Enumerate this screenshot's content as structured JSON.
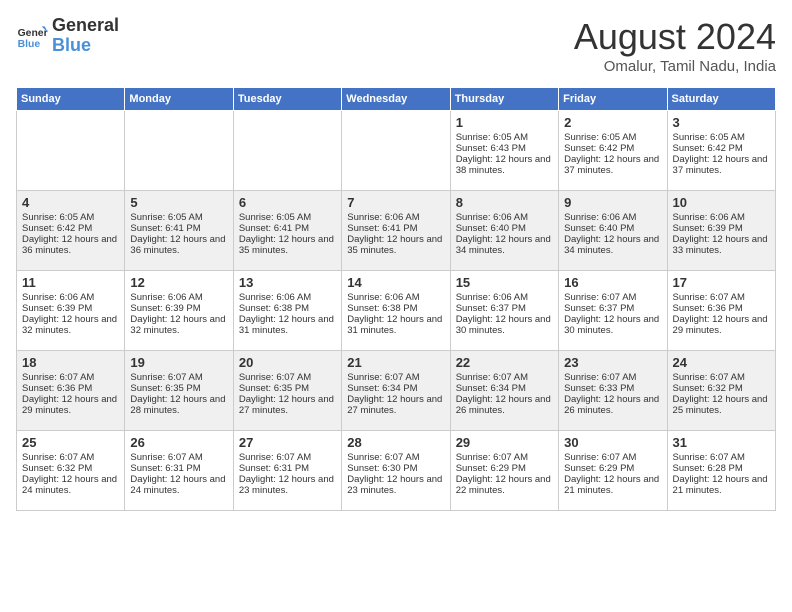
{
  "header": {
    "logo": {
      "line1": "General",
      "line2": "Blue"
    },
    "title": "August 2024",
    "subtitle": "Omalur, Tamil Nadu, India"
  },
  "weekdays": [
    "Sunday",
    "Monday",
    "Tuesday",
    "Wednesday",
    "Thursday",
    "Friday",
    "Saturday"
  ],
  "weeks": [
    [
      {
        "day": "",
        "empty": true
      },
      {
        "day": "",
        "empty": true
      },
      {
        "day": "",
        "empty": true
      },
      {
        "day": "",
        "empty": true
      },
      {
        "day": "1",
        "sunrise": "Sunrise: 6:05 AM",
        "sunset": "Sunset: 6:43 PM",
        "daylight": "Daylight: 12 hours and 38 minutes."
      },
      {
        "day": "2",
        "sunrise": "Sunrise: 6:05 AM",
        "sunset": "Sunset: 6:42 PM",
        "daylight": "Daylight: 12 hours and 37 minutes."
      },
      {
        "day": "3",
        "sunrise": "Sunrise: 6:05 AM",
        "sunset": "Sunset: 6:42 PM",
        "daylight": "Daylight: 12 hours and 37 minutes."
      }
    ],
    [
      {
        "day": "4",
        "sunrise": "Sunrise: 6:05 AM",
        "sunset": "Sunset: 6:42 PM",
        "daylight": "Daylight: 12 hours and 36 minutes."
      },
      {
        "day": "5",
        "sunrise": "Sunrise: 6:05 AM",
        "sunset": "Sunset: 6:41 PM",
        "daylight": "Daylight: 12 hours and 36 minutes."
      },
      {
        "day": "6",
        "sunrise": "Sunrise: 6:05 AM",
        "sunset": "Sunset: 6:41 PM",
        "daylight": "Daylight: 12 hours and 35 minutes."
      },
      {
        "day": "7",
        "sunrise": "Sunrise: 6:06 AM",
        "sunset": "Sunset: 6:41 PM",
        "daylight": "Daylight: 12 hours and 35 minutes."
      },
      {
        "day": "8",
        "sunrise": "Sunrise: 6:06 AM",
        "sunset": "Sunset: 6:40 PM",
        "daylight": "Daylight: 12 hours and 34 minutes."
      },
      {
        "day": "9",
        "sunrise": "Sunrise: 6:06 AM",
        "sunset": "Sunset: 6:40 PM",
        "daylight": "Daylight: 12 hours and 34 minutes."
      },
      {
        "day": "10",
        "sunrise": "Sunrise: 6:06 AM",
        "sunset": "Sunset: 6:39 PM",
        "daylight": "Daylight: 12 hours and 33 minutes."
      }
    ],
    [
      {
        "day": "11",
        "sunrise": "Sunrise: 6:06 AM",
        "sunset": "Sunset: 6:39 PM",
        "daylight": "Daylight: 12 hours and 32 minutes."
      },
      {
        "day": "12",
        "sunrise": "Sunrise: 6:06 AM",
        "sunset": "Sunset: 6:39 PM",
        "daylight": "Daylight: 12 hours and 32 minutes."
      },
      {
        "day": "13",
        "sunrise": "Sunrise: 6:06 AM",
        "sunset": "Sunset: 6:38 PM",
        "daylight": "Daylight: 12 hours and 31 minutes."
      },
      {
        "day": "14",
        "sunrise": "Sunrise: 6:06 AM",
        "sunset": "Sunset: 6:38 PM",
        "daylight": "Daylight: 12 hours and 31 minutes."
      },
      {
        "day": "15",
        "sunrise": "Sunrise: 6:06 AM",
        "sunset": "Sunset: 6:37 PM",
        "daylight": "Daylight: 12 hours and 30 minutes."
      },
      {
        "day": "16",
        "sunrise": "Sunrise: 6:07 AM",
        "sunset": "Sunset: 6:37 PM",
        "daylight": "Daylight: 12 hours and 30 minutes."
      },
      {
        "day": "17",
        "sunrise": "Sunrise: 6:07 AM",
        "sunset": "Sunset: 6:36 PM",
        "daylight": "Daylight: 12 hours and 29 minutes."
      }
    ],
    [
      {
        "day": "18",
        "sunrise": "Sunrise: 6:07 AM",
        "sunset": "Sunset: 6:36 PM",
        "daylight": "Daylight: 12 hours and 29 minutes."
      },
      {
        "day": "19",
        "sunrise": "Sunrise: 6:07 AM",
        "sunset": "Sunset: 6:35 PM",
        "daylight": "Daylight: 12 hours and 28 minutes."
      },
      {
        "day": "20",
        "sunrise": "Sunrise: 6:07 AM",
        "sunset": "Sunset: 6:35 PM",
        "daylight": "Daylight: 12 hours and 27 minutes."
      },
      {
        "day": "21",
        "sunrise": "Sunrise: 6:07 AM",
        "sunset": "Sunset: 6:34 PM",
        "daylight": "Daylight: 12 hours and 27 minutes."
      },
      {
        "day": "22",
        "sunrise": "Sunrise: 6:07 AM",
        "sunset": "Sunset: 6:34 PM",
        "daylight": "Daylight: 12 hours and 26 minutes."
      },
      {
        "day": "23",
        "sunrise": "Sunrise: 6:07 AM",
        "sunset": "Sunset: 6:33 PM",
        "daylight": "Daylight: 12 hours and 26 minutes."
      },
      {
        "day": "24",
        "sunrise": "Sunrise: 6:07 AM",
        "sunset": "Sunset: 6:32 PM",
        "daylight": "Daylight: 12 hours and 25 minutes."
      }
    ],
    [
      {
        "day": "25",
        "sunrise": "Sunrise: 6:07 AM",
        "sunset": "Sunset: 6:32 PM",
        "daylight": "Daylight: 12 hours and 24 minutes."
      },
      {
        "day": "26",
        "sunrise": "Sunrise: 6:07 AM",
        "sunset": "Sunset: 6:31 PM",
        "daylight": "Daylight: 12 hours and 24 minutes."
      },
      {
        "day": "27",
        "sunrise": "Sunrise: 6:07 AM",
        "sunset": "Sunset: 6:31 PM",
        "daylight": "Daylight: 12 hours and 23 minutes."
      },
      {
        "day": "28",
        "sunrise": "Sunrise: 6:07 AM",
        "sunset": "Sunset: 6:30 PM",
        "daylight": "Daylight: 12 hours and 23 minutes."
      },
      {
        "day": "29",
        "sunrise": "Sunrise: 6:07 AM",
        "sunset": "Sunset: 6:29 PM",
        "daylight": "Daylight: 12 hours and 22 minutes."
      },
      {
        "day": "30",
        "sunrise": "Sunrise: 6:07 AM",
        "sunset": "Sunset: 6:29 PM",
        "daylight": "Daylight: 12 hours and 21 minutes."
      },
      {
        "day": "31",
        "sunrise": "Sunrise: 6:07 AM",
        "sunset": "Sunset: 6:28 PM",
        "daylight": "Daylight: 12 hours and 21 minutes."
      }
    ]
  ]
}
